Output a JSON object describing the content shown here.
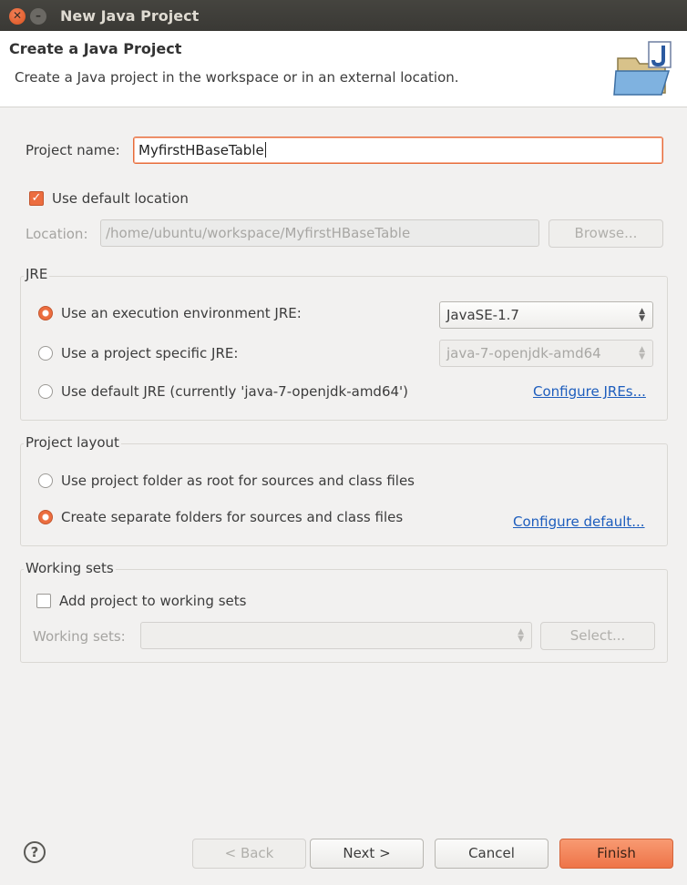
{
  "window": {
    "title": "New Java Project"
  },
  "header": {
    "title": "Create a Java Project",
    "description": "Create a Java project in the workspace or in an external location.",
    "icon": "java-folder-icon"
  },
  "project": {
    "name_label": "Project name:",
    "name_value": "MyfirstHBaseTable",
    "use_default_location_label": "Use default location",
    "use_default_location_checked": true,
    "location_label": "Location:",
    "location_value": "/home/ubuntu/workspace/MyfirstHBaseTable",
    "browse_label": "Browse..."
  },
  "jre": {
    "group_label": "JRE",
    "option_exec_env": "Use an execution environment JRE:",
    "option_project_specific": "Use a project specific JRE:",
    "option_default": "Use default JRE (currently 'java-7-openjdk-amd64')",
    "selected": "option_exec_env",
    "exec_env_value": "JavaSE-1.7",
    "project_specific_value": "java-7-openjdk-amd64",
    "configure_link": "Configure JREs..."
  },
  "layout": {
    "group_label": "Project layout",
    "option_root": "Use project folder as root for sources and class files",
    "option_separate": "Create separate folders for sources and class files",
    "selected": "option_separate",
    "configure_link": "Configure default..."
  },
  "working_sets": {
    "group_label": "Working sets",
    "add_label": "Add project to working sets",
    "add_checked": false,
    "sets_label": "Working sets:",
    "sets_value": "",
    "select_label": "Select..."
  },
  "footer": {
    "back_label": "< Back",
    "next_label": "Next >",
    "cancel_label": "Cancel",
    "finish_label": "Finish"
  },
  "colors": {
    "accent": "#ec6d3f",
    "link": "#1d5dbd",
    "titlebar": "#3c3b37"
  }
}
